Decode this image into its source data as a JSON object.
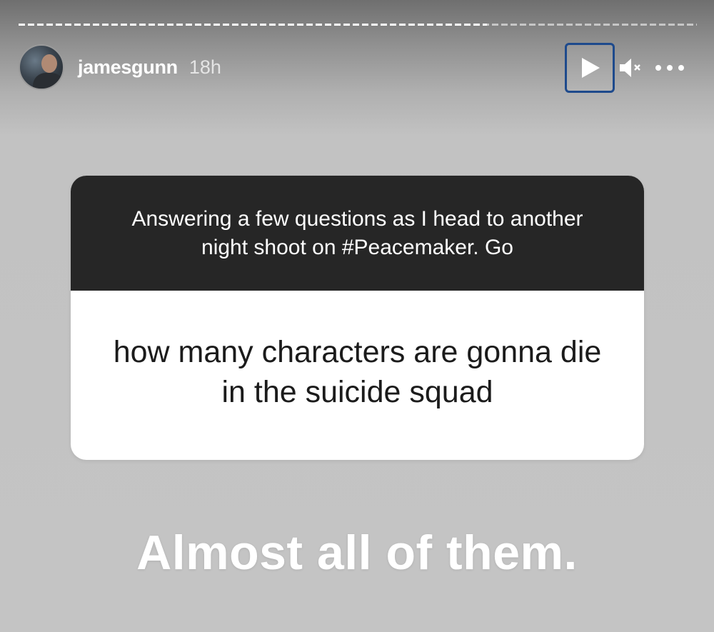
{
  "story": {
    "progress": 0.69,
    "user": {
      "username": "jamesgunn",
      "timestamp": "18h"
    },
    "controls": {
      "play_icon": "play-icon",
      "mute_icon": "speaker-muted-icon",
      "more_icon": "more-horizontal-icon"
    },
    "question_card": {
      "prompt": "Answering a few questions as I head to another night shoot on #Peacemaker. Go",
      "question": "how many characters are gonna die in the suicide squad"
    },
    "answer": "Almost all of them."
  }
}
